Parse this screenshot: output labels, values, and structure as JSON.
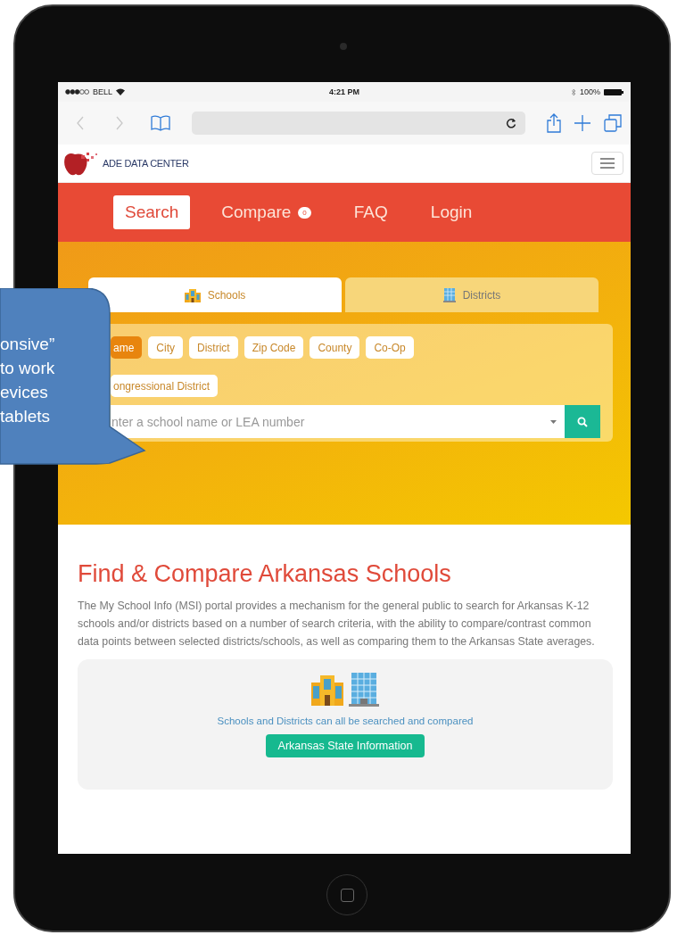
{
  "status_bar": {
    "carrier": "BELL",
    "time": "4:21 PM",
    "battery": "100%"
  },
  "browser_nav": [
    {
      "kind": "back",
      "disabled": true
    },
    {
      "kind": "forward",
      "disabled": true
    }
  ],
  "site": {
    "logo_text": "ADE DATA CENTER"
  },
  "nav": [
    {
      "label": "Search",
      "selected": true
    },
    {
      "label": "Compare",
      "badge": "0",
      "selected": false
    },
    {
      "label": "FAQ",
      "selected": false
    },
    {
      "label": "Login",
      "selected": false
    }
  ],
  "search_tabs": [
    {
      "label": "Schools",
      "selected": true
    },
    {
      "label": "Districts",
      "selected": false
    }
  ],
  "filters": [
    {
      "label": "ame",
      "selected": true
    },
    {
      "label": "City",
      "selected": false
    },
    {
      "label": "District",
      "selected": false
    },
    {
      "label": "Zip Code",
      "selected": false
    },
    {
      "label": "County",
      "selected": false
    },
    {
      "label": "Co-Op",
      "selected": false
    },
    {
      "label": "ongressional District",
      "selected": false
    }
  ],
  "search_field": {
    "placeholder": "nter a school name or LEA number"
  },
  "intro": {
    "title": "Find & Compare Arkansas Schools",
    "text": "The My School Info (MSI) portal provides a mechanism for the general public to search for Arkansas K-12 schools and/or districts based on a number of search criteria, with the ability to compare/contrast common data points between selected districts/schools, as well as comparing them to the Arkansas State averages."
  },
  "info_card": {
    "caption": "Schools and Districts can all be searched and compared",
    "button": "Arkansas State Information"
  },
  "callout": {
    "lines": [
      "onsive”",
      "to work",
      "evices",
      "tablets"
    ]
  }
}
